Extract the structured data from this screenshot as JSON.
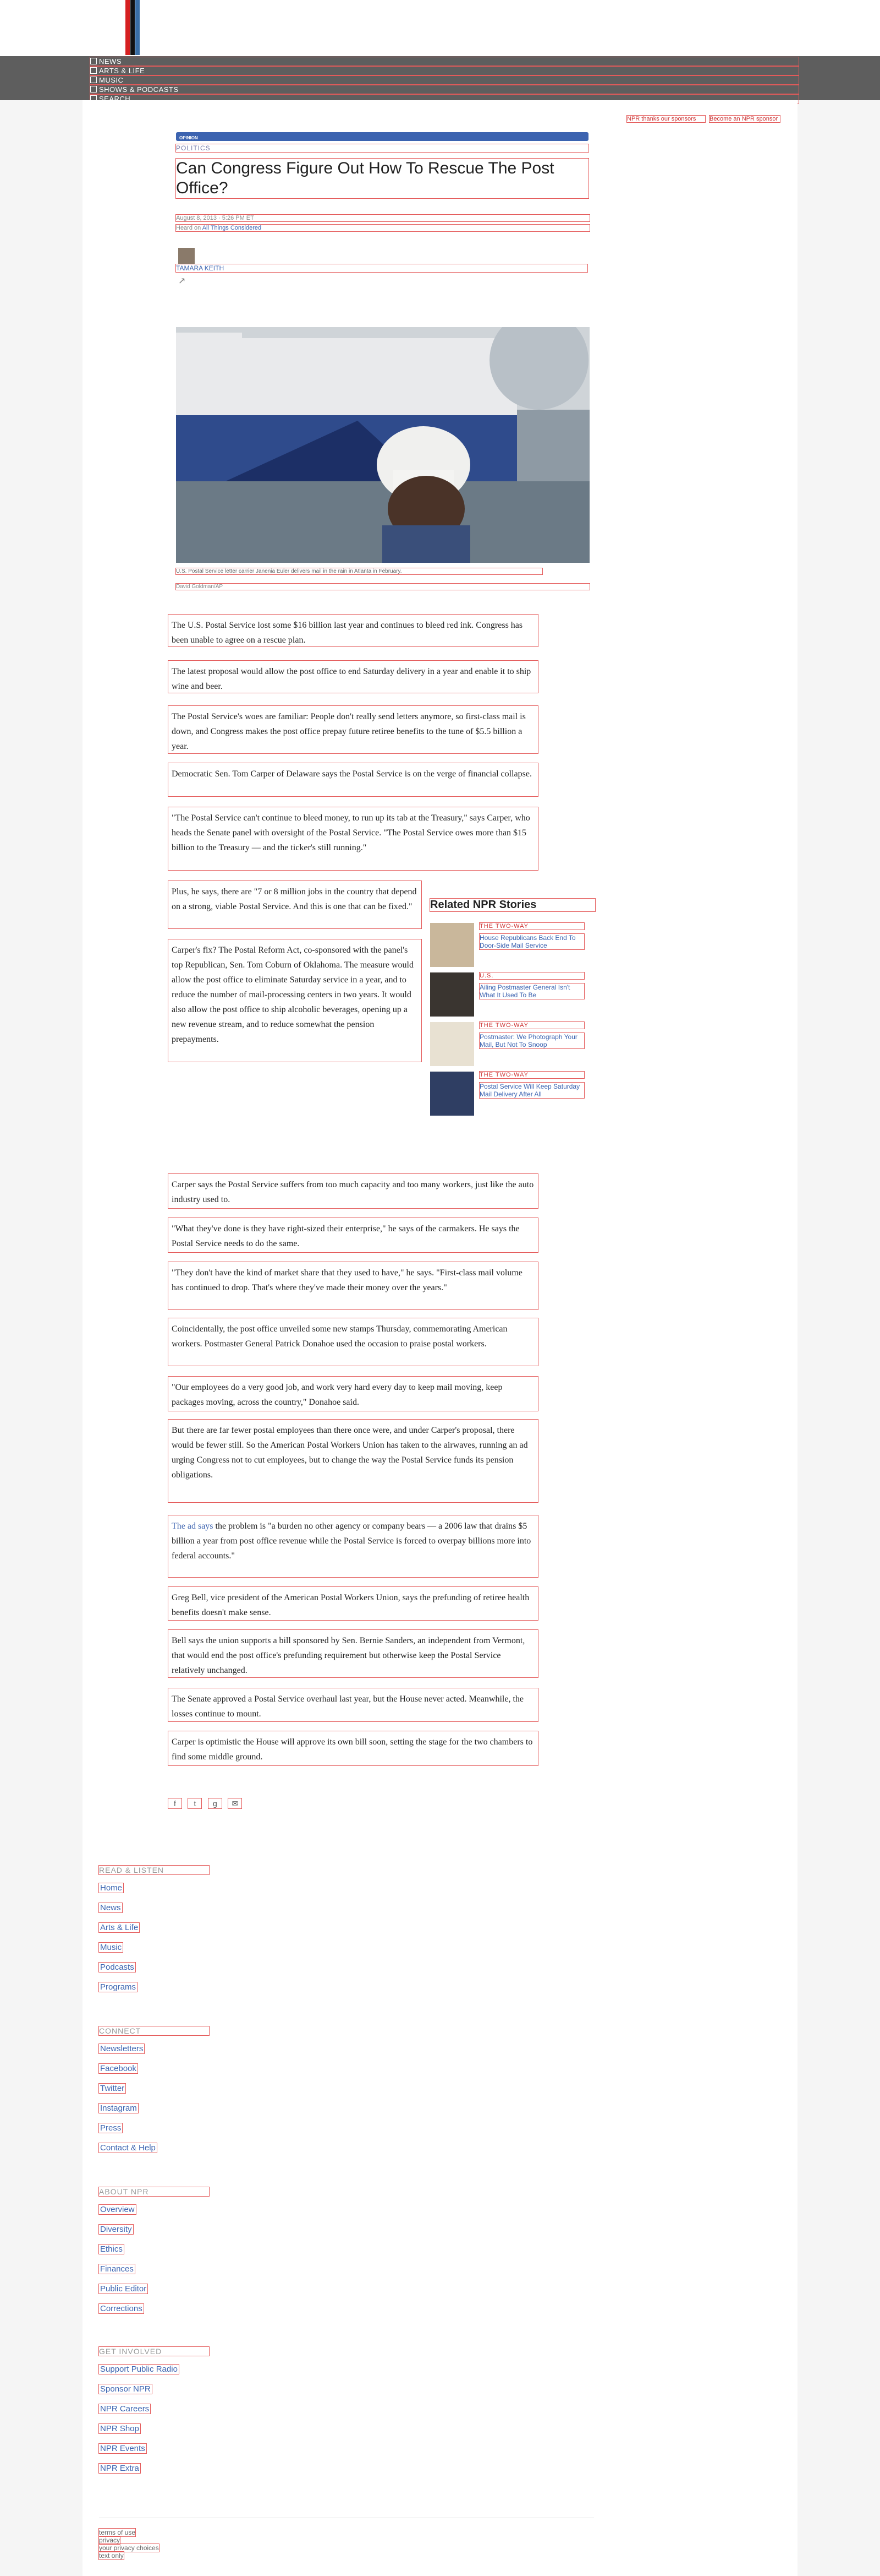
{
  "header": {
    "nav_items": [
      "NEWS",
      "ARTS & LIFE",
      "MUSIC",
      "SHOWS & PODCASTS",
      "SEARCH"
    ]
  },
  "top_links": {
    "shop": "NPR thanks our sponsors",
    "become": "Become an NPR sponsor"
  },
  "article": {
    "tag": "OPINION",
    "section": "POLITICS",
    "title": "Can Congress Figure Out How To Rescue The Post Office?",
    "date": "August 8, 2013 · 5:26 PM ET",
    "heard_prefix": "Heard on ",
    "heard_show": "All Things Considered",
    "byline": "TAMARA KEITH",
    "caption": "U.S. Postal Service letter carrier Janenia Euler delivers mail in the rain in Atlanta in February.",
    "credit": "David Goldman/AP",
    "paragraphs": [
      "The U.S. Postal Service lost some $16 billion last year and continues to bleed red ink. Congress has been unable to agree on a rescue plan.",
      "The latest proposal would allow the post office to end Saturday delivery in a year and enable it to ship wine and beer.",
      "The Postal Service's woes are familiar: People don't really send letters anymore, so first-class mail is down, and Congress makes the post office prepay future retiree benefits to the tune of $5.5 billion a year.",
      "Democratic Sen. Tom Carper of Delaware says the Postal Service is on the verge of financial collapse.",
      "\"The Postal Service can't continue to bleed money, to run up its tab at the Treasury,\" says Carper, who heads the Senate panel with oversight of the Postal Service. \"The Postal Service owes more than $15 billion to the Treasury — and the ticker's still running.\"",
      "Plus, he says, there are \"7 or 8 million jobs in the country that depend on a strong, viable Postal Service. And this is one that can be fixed.\"",
      "Carper's fix? The Postal Reform Act, co-sponsored with the panel's top Republican, Sen. Tom Coburn of Oklahoma. The measure would allow the post office to eliminate Saturday service in a year, and to reduce the number of mail-processing centers in two years. It would also allow the post office to ship alcoholic beverages, opening up a new revenue stream, and to reduce somewhat the pension prepayments.",
      "Carper says the Postal Service suffers from too much capacity and too many workers, just like the auto industry used to.",
      "\"What they've done is they have right-sized their enterprise,\" he says of the carmakers. He says the Postal Service needs to do the same.",
      "\"They don't have the kind of market share that they used to have,\" he says. \"First-class mail volume has continued to drop. That's where they've made their money over the years.\"",
      "Coincidentally, the post office unveiled some new stamps Thursday, commemorating American workers. Postmaster General Patrick Donahoe used the occasion to praise postal workers.",
      "\"Our employees do a very good job, and work very hard every day to keep mail moving, keep packages moving, across the country,\" Donahoe said.",
      "But there are far fewer postal employees than there once were, and under Carper's proposal, there would be fewer still. So the American Postal Workers Union has taken to the airwaves, running an ad urging Congress not to cut employees, but to change the way the Postal Service funds its pension obligations.",
      "the problem is \"a burden no other agency or company bears — a 2006 law that drains $5 billion a year from post office revenue while the Postal Service is forced to overpay billions more into federal accounts.\"",
      "Greg Bell, vice president of the American Postal Workers Union, says the prefunding of retiree health benefits doesn't make sense.",
      "Bell says the union supports a bill sponsored by Sen. Bernie Sanders, an independent from Vermont, that would end the post office's prefunding requirement but otherwise keep the Postal Service relatively unchanged.",
      "The Senate approved a Postal Service overhaul last year, but the House never acted. Meanwhile, the losses continue to mount.",
      "Carper is optimistic the House will approve its own bill soon, setting the stage for the two chambers to find some middle ground."
    ],
    "ad_link": "The ad says"
  },
  "related": {
    "title": "Related NPR Stories",
    "items": [
      {
        "kicker": "THE TWO-WAY",
        "head": "House Republicans Back End To Door-Side Mail Service"
      },
      {
        "kicker": "U.S.",
        "head": "Ailing Postmaster General Isn't What It Used To Be"
      },
      {
        "kicker": "THE TWO-WAY",
        "head": "Postmaster: We Photograph Your Mail, But Not To Snoop"
      },
      {
        "kicker": "THE TWO-WAY",
        "head": "Postal Service Will Keep Saturday Mail Delivery After All"
      }
    ]
  },
  "share": {
    "icons": [
      "f",
      "t",
      "g",
      "✉"
    ]
  },
  "footer": {
    "read_listen": {
      "heading": "READ & LISTEN",
      "links": [
        "Home",
        "News",
        "Arts & Life",
        "Music",
        "Podcasts",
        "Programs"
      ]
    },
    "connect": {
      "heading": "CONNECT",
      "links": [
        "Newsletters",
        "Facebook",
        "Twitter",
        "Instagram",
        "Press",
        "Contact & Help"
      ]
    },
    "about": {
      "heading": "ABOUT NPR",
      "links": [
        "Overview",
        "Diversity",
        "Ethics",
        "Finances",
        "Public Editor",
        "Corrections"
      ]
    },
    "involved": {
      "heading": "GET INVOLVED",
      "links": [
        "Support Public Radio",
        "Sponsor NPR",
        "NPR Careers",
        "NPR Shop",
        "NPR Events",
        "NPR Extra"
      ]
    },
    "legal": [
      "terms of use",
      "privacy",
      "your privacy choices",
      "text only"
    ]
  },
  "colors": {
    "accent": "#3c63b0",
    "nav_bg": "#5e5e5e",
    "logo": [
      "#d62021",
      "#111111",
      "#3a6ea5"
    ]
  }
}
